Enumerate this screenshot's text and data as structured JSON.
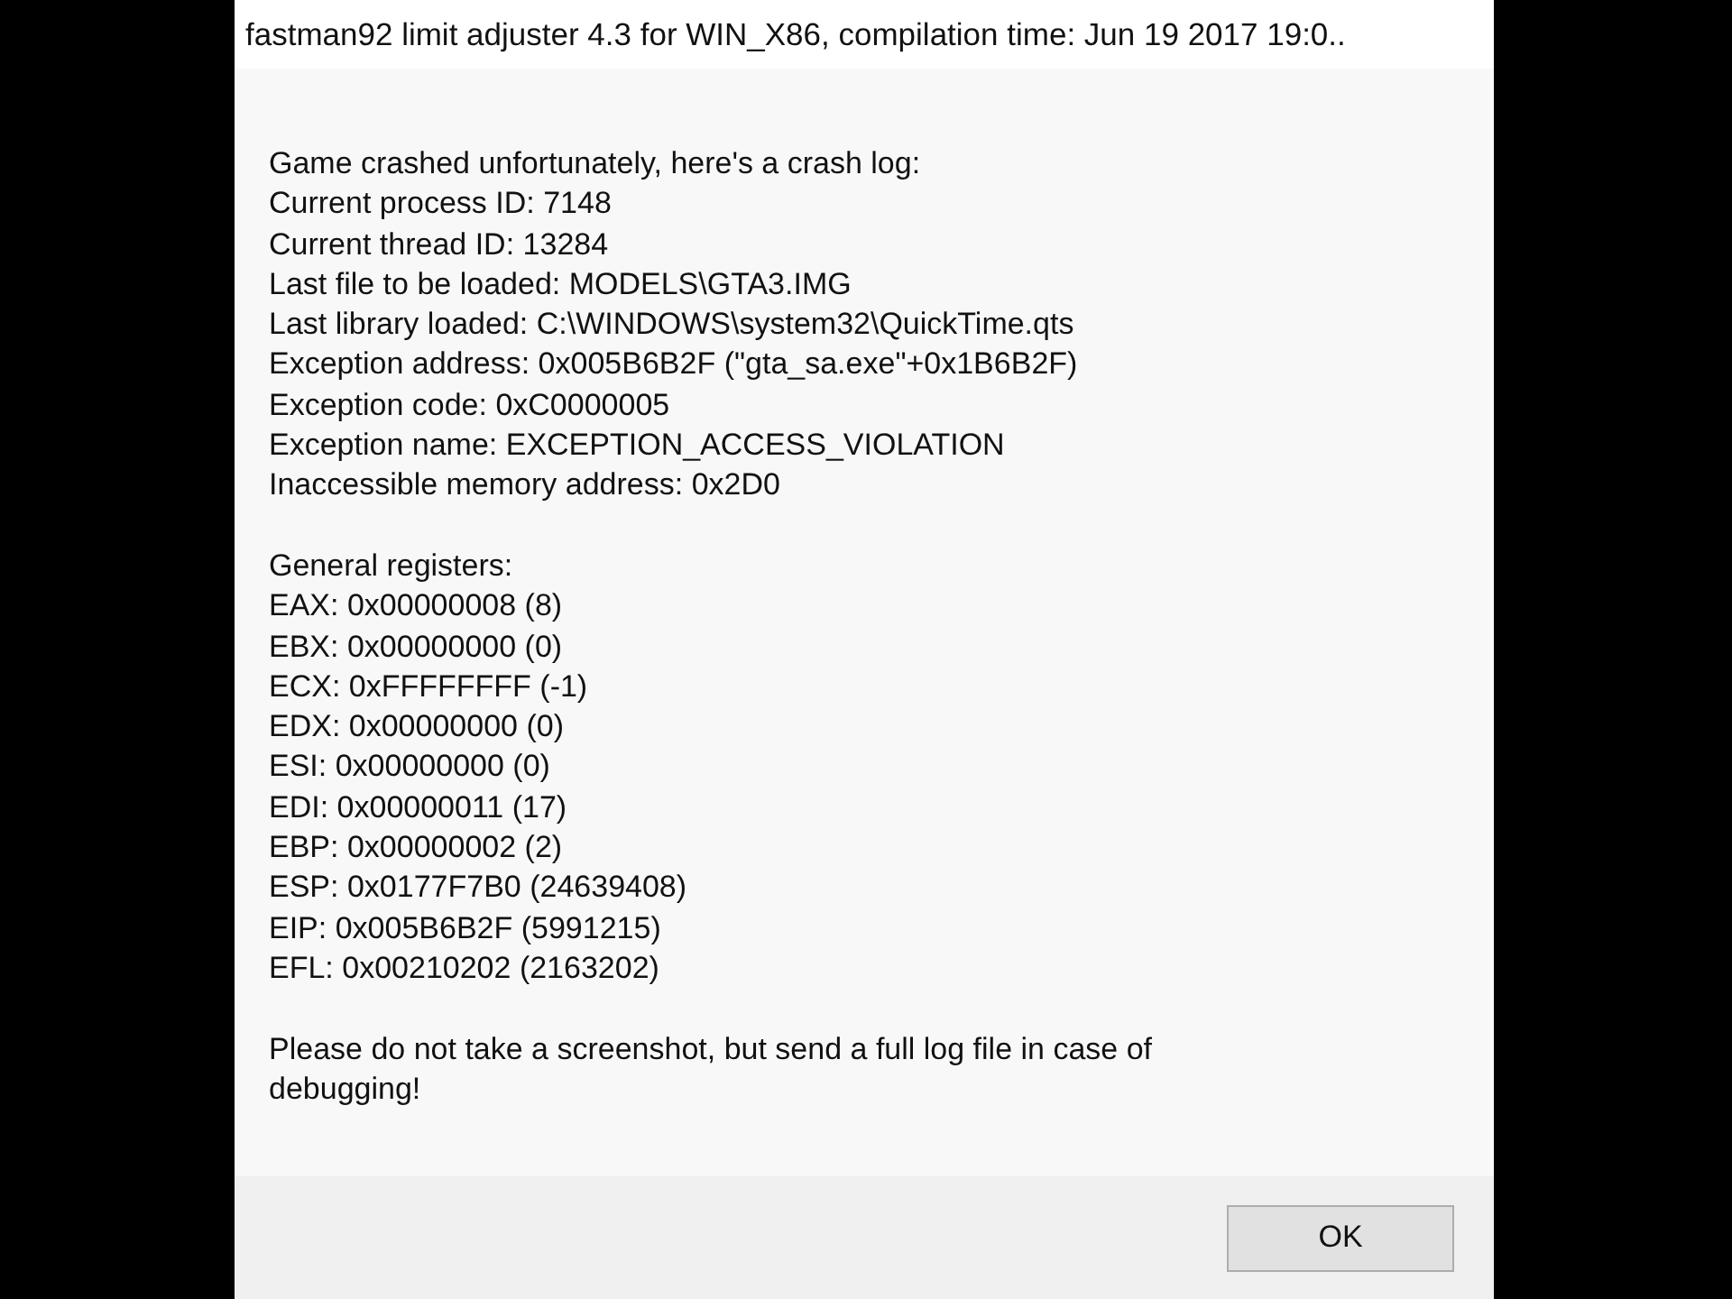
{
  "window": {
    "title": "fastman92 limit adjuster 4.3 for WIN_X86, compilation time: Jun 19 2017 19:0.."
  },
  "message": {
    "groups": [
      [
        "Game crashed unfortunately, here's a crash log:",
        "Current process ID: 7148",
        "Current thread ID: 13284",
        "Last file to be loaded: MODELS\\GTA3.IMG",
        "Last library loaded: C:\\WINDOWS\\system32\\QuickTime.qts",
        "Exception address: 0x005B6B2F (\"gta_sa.exe\"+0x1B6B2F)",
        "Exception code: 0xC0000005",
        "Exception name: EXCEPTION_ACCESS_VIOLATION",
        "Inaccessible memory address: 0x2D0"
      ],
      [
        "General registers:",
        "EAX: 0x00000008 (8)",
        "EBX: 0x00000000 (0)",
        "ECX: 0xFFFFFFFF (-1)",
        "EDX: 0x00000000 (0)",
        "ESI: 0x00000000 (0)",
        "EDI: 0x00000011 (17)",
        "EBP: 0x00000002 (2)",
        "ESP: 0x0177F7B0 (24639408)",
        "EIP: 0x005B6B2F (5991215)",
        "EFL: 0x00210202 (2163202)"
      ]
    ],
    "note": "Please do not take a screenshot, but send a full log file in case of debugging!"
  },
  "buttons": [
    "OK"
  ]
}
